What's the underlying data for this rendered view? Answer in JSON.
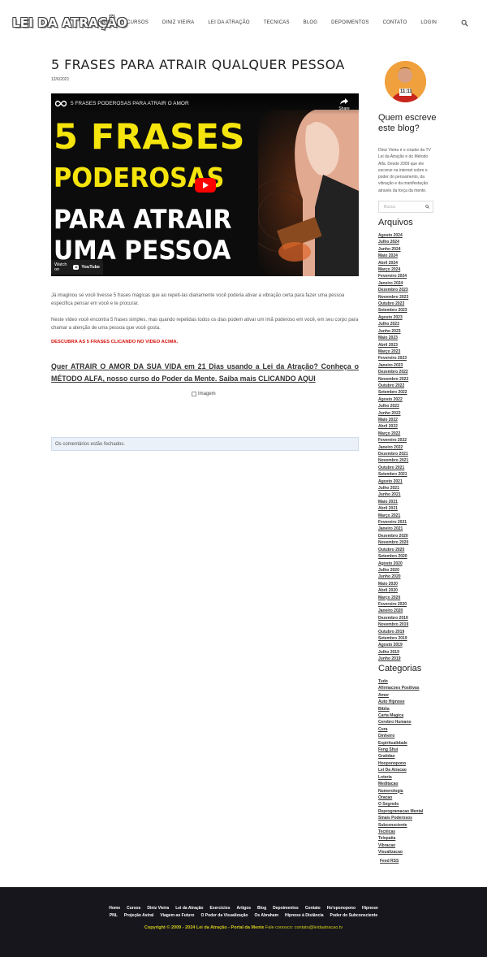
{
  "header": {
    "logo": "LEI DA ATRAÇÃO",
    "nav": [
      "Home",
      "CURSOS",
      "DINIZ VIEIRA",
      "LEI DA ATRAÇÃO",
      "TECNICAS",
      "BLOG",
      "DEPOIMENTOS",
      "CONTATO",
      "LOGIN"
    ]
  },
  "post": {
    "title": "5 FRASES PARA ATRAIR QUALQUER PESSOA",
    "date": "12/6/2021",
    "video": {
      "channel_title": "5 FRASES PODEROSAS PARA ATRAIR O AMOR",
      "share": "Share",
      "thumb_line1": "5 FRASES",
      "thumb_line2": "PODEROSAS",
      "thumb_line3": "PARA ATRAIR",
      "thumb_line4": "UMA PESSOA",
      "watch_on": "Watch on",
      "youtube": "YouTube"
    },
    "para1": "Já imaginou se você tivesse 5 frases mágicas que ao repeti-las diariamente você poderia ativar a vibração certa para fazer uma pessoa especifica pensar em você e te procurar.",
    "para2": "Neste vídeo você encontra 5 frases simples, mas quando repetidas todos os dias podem ativar um imã poderoso em você, em seu corpo para chamar a atenção de uma pessoa que você gosta.",
    "red_note": "DESCUBRA AS 5 FRASES CLICANDO NO VIDEO ACIMA.",
    "cta": "Quer ATRAIR O AMOR DA SUA VIDA em 21 Dias usando a Lei da Atração? Conheça o MÉTODO ALFA, nosso curso do Poder da Mente. Saiba mais CLICANDO AQUI",
    "image_alt": "Imagem",
    "comments_closed": "Os comentários estão fechados."
  },
  "sidebar": {
    "author_heading": "Quem escreve este blog?",
    "author_text": "Diniz Vieira é o criador da TV Lei da Atração e do Método Alfa. Desde 2009 que ele escreve na internet sobre o poder do pensamento, da vibração e da manifestação através da força da mente.",
    "avatar_text": "11:11",
    "search_placeholder": "Busca",
    "archives_heading": "Arquivos",
    "archives": [
      "Agosto 2024",
      "Julho 2024",
      "Junho 2024",
      "Maio 2024",
      "Abril 2024",
      "Março 2024",
      "Fevereiro 2024",
      "Janeiro 2024",
      "Dezembro 2023",
      "Novembro 2023",
      "Outubro 2023",
      "Setembro 2023",
      "Agosto 2023",
      "Julho 2023",
      "Junho 2023",
      "Maio 2023",
      "Abril 2023",
      "Março 2023",
      "Fevereiro 2023",
      "Janeiro 2023",
      "Dezembro 2022",
      "Novembro 2022",
      "Outubro 2022",
      "Setembro 2022",
      "Agosto 2022",
      "Julho 2022",
      "Junho 2022",
      "Maio 2022",
      "Abril 2022",
      "Março 2022",
      "Fevereiro 2022",
      "Janeiro 2022",
      "Dezembro 2021",
      "Novembro 2021",
      "Outubro 2021",
      "Setembro 2021",
      "Agosto 2021",
      "Julho 2021",
      "Junho 2021",
      "Maio 2021",
      "Abril 2021",
      "Março 2021",
      "Fevereiro 2021",
      "Janeiro 2021",
      "Dezembro 2020",
      "Novembro 2020",
      "Outubro 2020",
      "Setembro 2020",
      "Agosto 2020",
      "Julho 2020",
      "Junho 2020",
      "Maio 2020",
      "Abril 2020",
      "Março 2020",
      "Fevereiro 2020",
      "Janeiro 2020",
      "Dezembro 2019",
      "Novembro 2019",
      "Outubro 2019",
      "Setembro 2019",
      "Agosto 2019",
      "Julho 2019",
      "Junho 2019"
    ],
    "categories_heading": "Categorias",
    "categories": [
      "Tudo",
      "Afirmacoes Positivas",
      "Amor",
      "Auto Hipnose",
      "Biblia",
      "Carta Magica",
      "Cerebro Humano",
      "Cura",
      "Dinheiro",
      "Espiritualidade",
      "Feng Shui",
      "Gratidao",
      "Hooponopono",
      "Lei Da Atracao",
      "Loteria",
      "Meditacao",
      "Numerologia",
      "Oracao",
      "O Segredo",
      "Reprogramacao Mental",
      "Sinais Poderosos",
      "Subconsciente",
      "Tecnicas",
      "Telepatia",
      "Vibracao",
      "Visualizacao"
    ],
    "feed": "Feed RSS"
  },
  "footer": {
    "row1": [
      "Home",
      "Cursos",
      "Diniz Vieira",
      "Lei da Atração",
      "Exercícios",
      "Artigos",
      "Blog",
      "Depoimentos",
      "Contato",
      "Ho'oponopono",
      "Hipnose"
    ],
    "row2": [
      "PNL",
      "Projeção Astral",
      "Viagem ao Futuro",
      "O Poder da Visualização",
      "Os Abraham",
      "Hipnose à Distância",
      "Poder do Subconsciente"
    ],
    "copyright": "Copyright © 2009 - 2024 Lei da Atração - Portal da Mente",
    "contact": " Fale conosco: contato@leidaatracao.tv"
  }
}
